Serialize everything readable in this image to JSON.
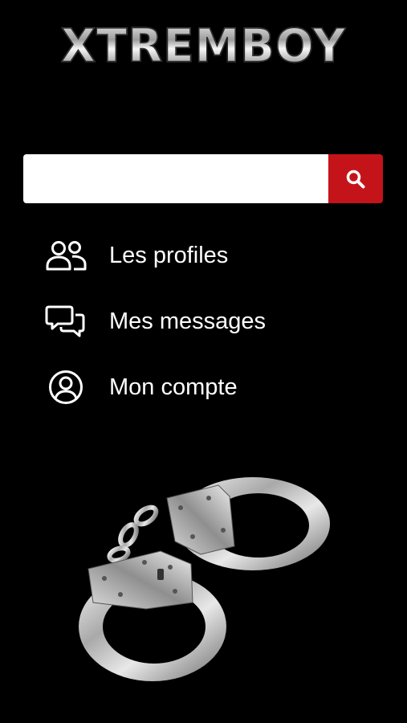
{
  "app": {
    "logo_text": "XTREMBOY"
  },
  "search": {
    "value": "",
    "placeholder": "",
    "button_icon": "search-icon"
  },
  "menu": {
    "items": [
      {
        "label": "Les profiles",
        "icon": "users-icon"
      },
      {
        "label": "Mes messages",
        "icon": "chat-bubbles-icon"
      },
      {
        "label": "Mon compte",
        "icon": "account-icon"
      }
    ]
  },
  "colors": {
    "background": "#000000",
    "accent": "#c4141a",
    "text": "#ffffff"
  }
}
